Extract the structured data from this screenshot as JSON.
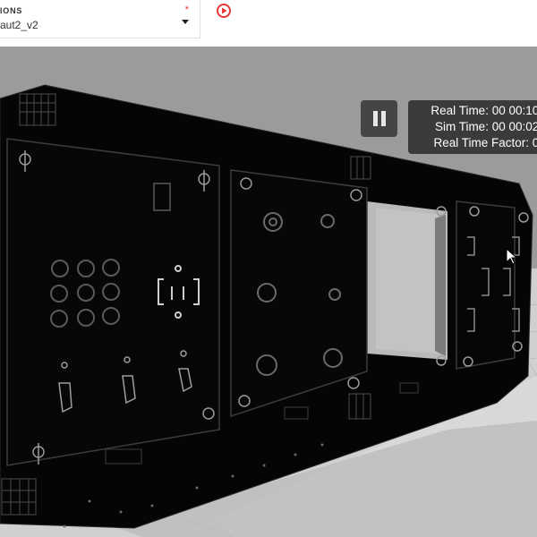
{
  "toolbar": {
    "selector_label": "IONS",
    "selector_value": "aut2_v2",
    "required_mark": "*",
    "play_icon": "play-circle-icon",
    "accent": "#e53935"
  },
  "viewport": {
    "pause_icon": "pause-icon",
    "background": "#9e9e9e",
    "floor": "#cfcfcf"
  },
  "stats": {
    "real_time": "Real Time: 00 00:10:",
    "sim_time": "Sim Time: 00 00:02:",
    "real_time_factor": "Real Time Factor: 0."
  }
}
